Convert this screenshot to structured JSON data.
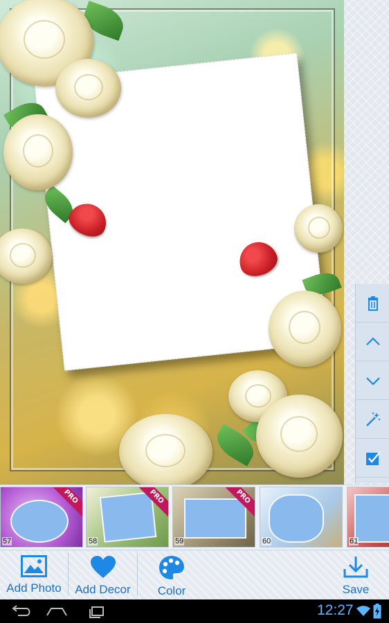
{
  "frames": [
    {
      "number": "57",
      "pro": true,
      "theme_color": "#b45ad4"
    },
    {
      "number": "58",
      "pro": true,
      "theme_color": "#6f9a4c"
    },
    {
      "number": "59",
      "pro": true,
      "theme_color": "#9b8f6f"
    },
    {
      "number": "60",
      "pro": false,
      "theme_color": "#a9c9e8"
    },
    {
      "number": "61",
      "pro": false,
      "theme_color": "#c84848"
    }
  ],
  "pro_badge": "PRO",
  "side_toolbar": {
    "icons": [
      "trash-icon",
      "chevron-up-icon",
      "chevron-down-icon",
      "magic-wand-icon",
      "checkbox-icon"
    ]
  },
  "actions": {
    "add_photo": "Add Photo",
    "add_decor": "Add Decor",
    "color": "Color",
    "save": "Save"
  },
  "status": {
    "time": "12:27"
  },
  "colors": {
    "accent": "#1f6fc0",
    "icon_blue": "#1e88e5",
    "clock": "#5fb3ff"
  }
}
